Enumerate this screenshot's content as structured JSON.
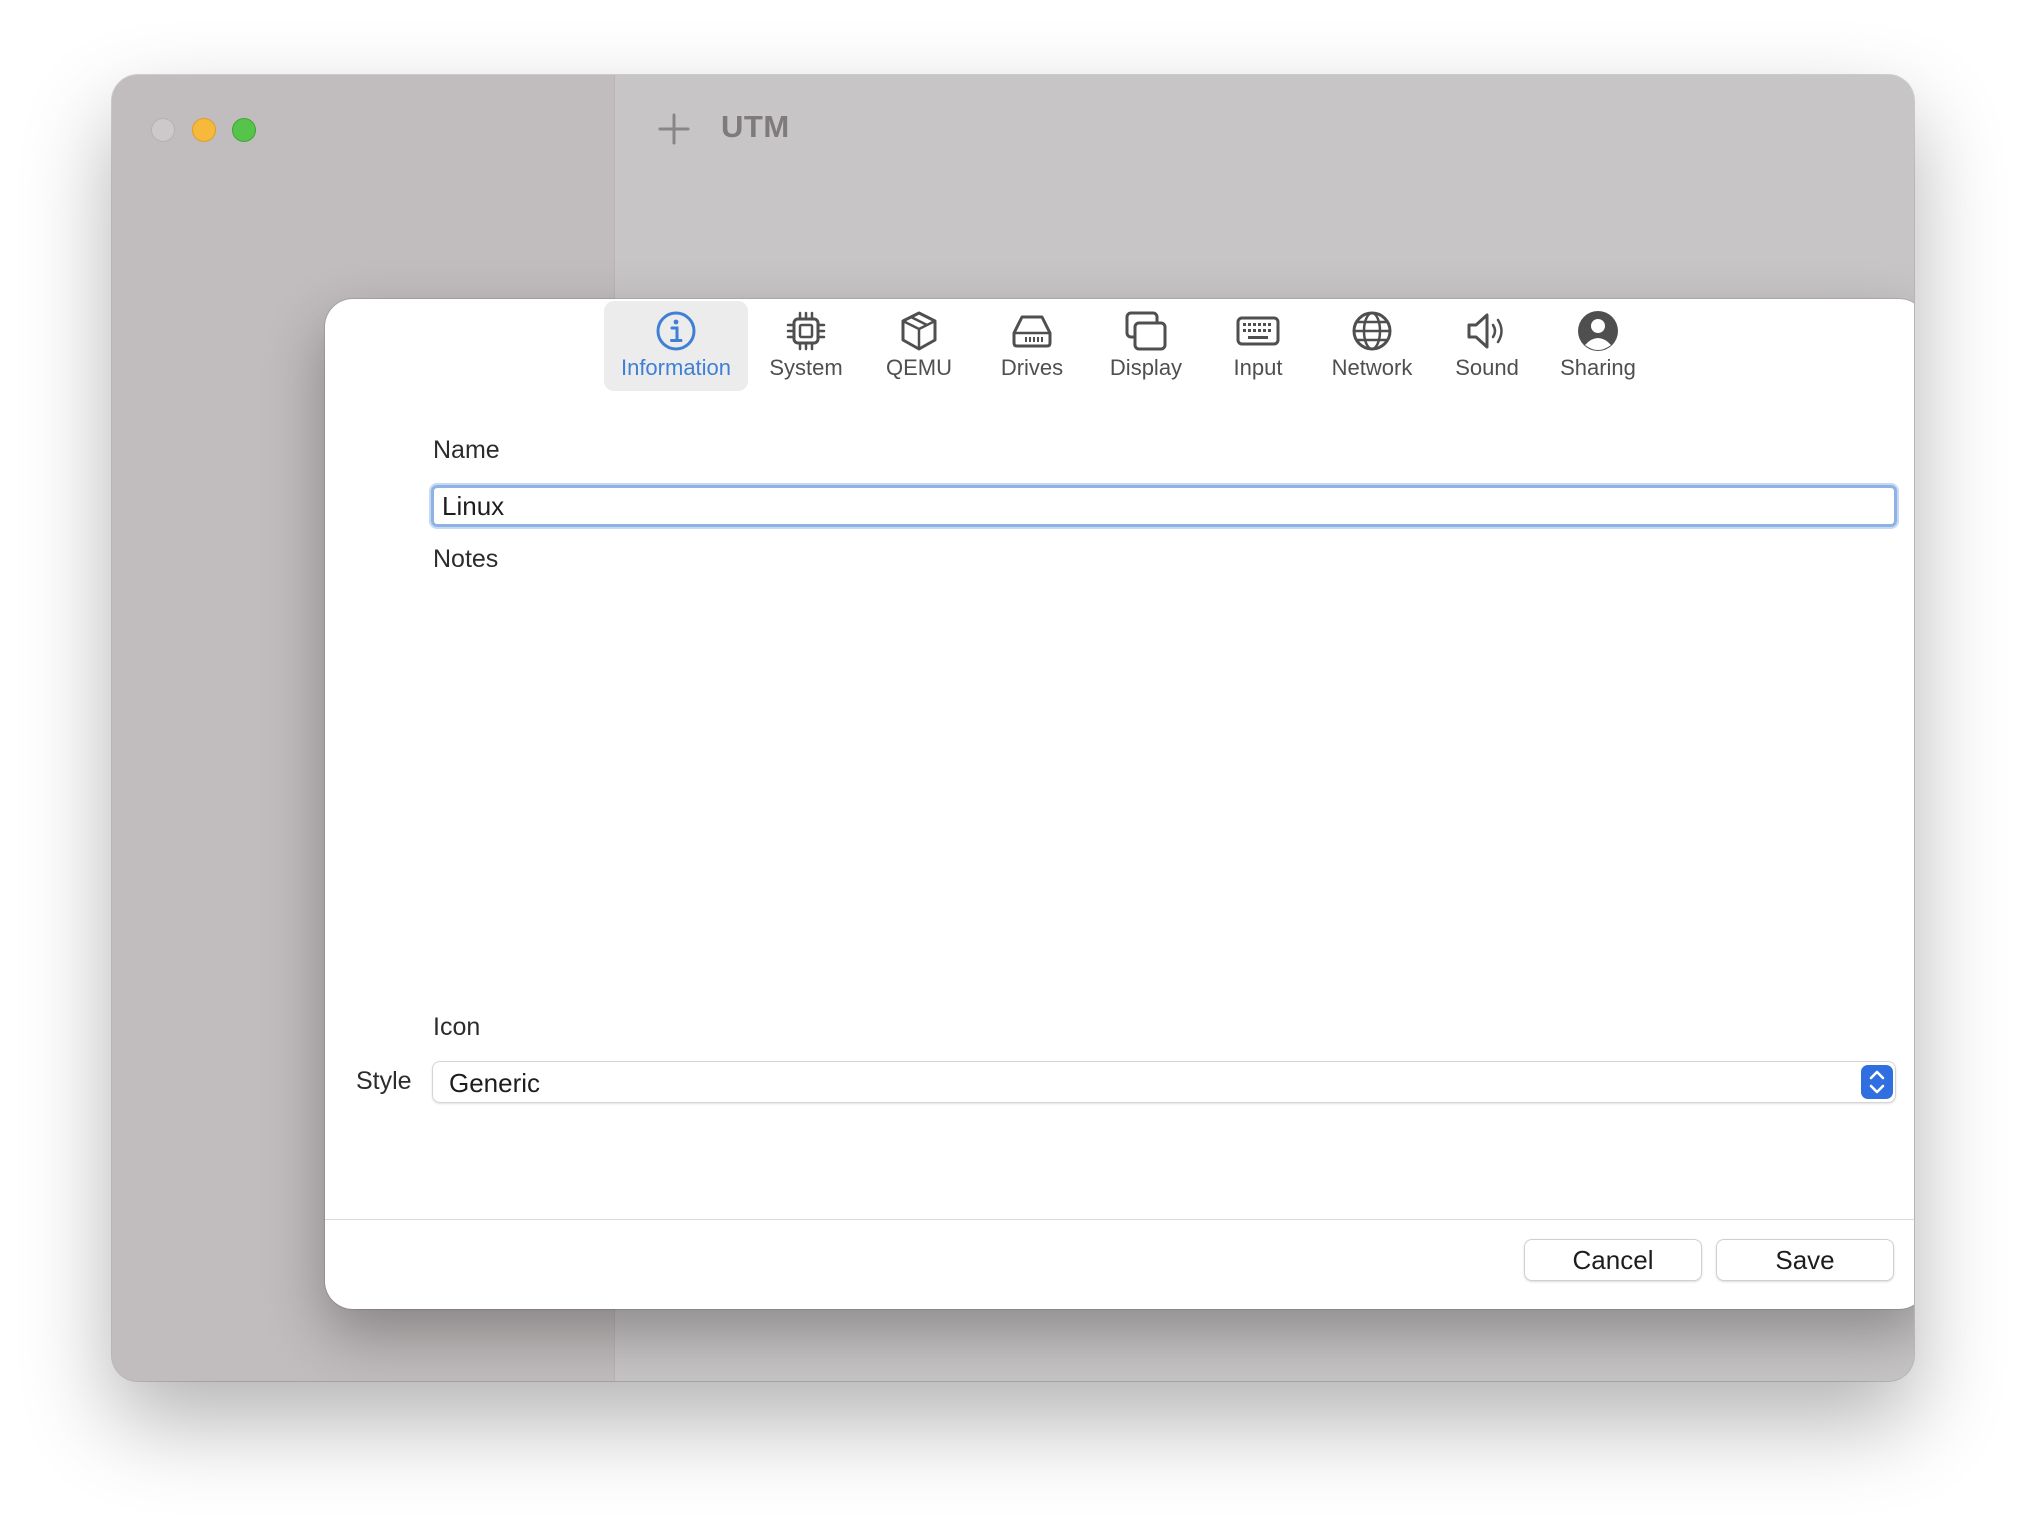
{
  "window": {
    "title": "UTM"
  },
  "tabs": [
    {
      "label": "Information",
      "icon": "info-circle-icon",
      "active": true
    },
    {
      "label": "System",
      "icon": "cpu-icon"
    },
    {
      "label": "QEMU",
      "icon": "box-icon"
    },
    {
      "label": "Drives",
      "icon": "drive-icon"
    },
    {
      "label": "Display",
      "icon": "display-icon"
    },
    {
      "label": "Input",
      "icon": "keyboard-icon"
    },
    {
      "label": "Network",
      "icon": "globe-icon"
    },
    {
      "label": "Sound",
      "icon": "speaker-icon"
    },
    {
      "label": "Sharing",
      "icon": "person-icon"
    }
  ],
  "form": {
    "name_label": "Name",
    "name_value": "Linux",
    "notes_label": "Notes",
    "notes_value": "",
    "icon_label": "Icon",
    "style_label": "Style",
    "style_value": "Generic"
  },
  "buttons": {
    "cancel": "Cancel",
    "save": "Save"
  },
  "colors": {
    "accent": "#3f7fd6",
    "select_stepper": "#2f6fe0",
    "focus_ring": "#8eb2e4"
  }
}
